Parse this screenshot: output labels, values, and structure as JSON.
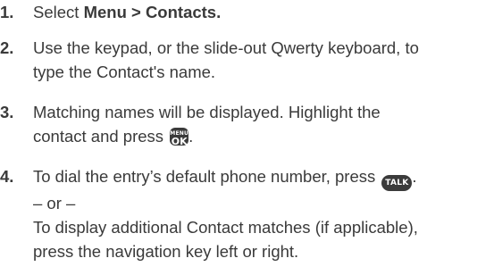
{
  "steps": [
    {
      "number": "1.",
      "lines": [
        {
          "pre": "Select ",
          "bold": "Menu > Contacts."
        }
      ]
    },
    {
      "number": "2.",
      "lines": [
        "Use the keypad, or the slide-out Qwerty keyboard, to",
        "type the Contact's name."
      ]
    },
    {
      "number": "3.",
      "lines": [
        "Matching names will be displayed. Highlight the",
        {
          "pre": "contact and press ",
          "key_top": "MENU",
          "key_main": "OK",
          "post": "."
        }
      ]
    },
    {
      "number": "4.",
      "lines": [
        {
          "pre": "To dial the entry’s default phone number, press ",
          "key": "TALK",
          "post": "."
        },
        "– or –",
        "To display additional Contact matches (if applicable),",
        "press the navigation key left or right."
      ]
    }
  ]
}
